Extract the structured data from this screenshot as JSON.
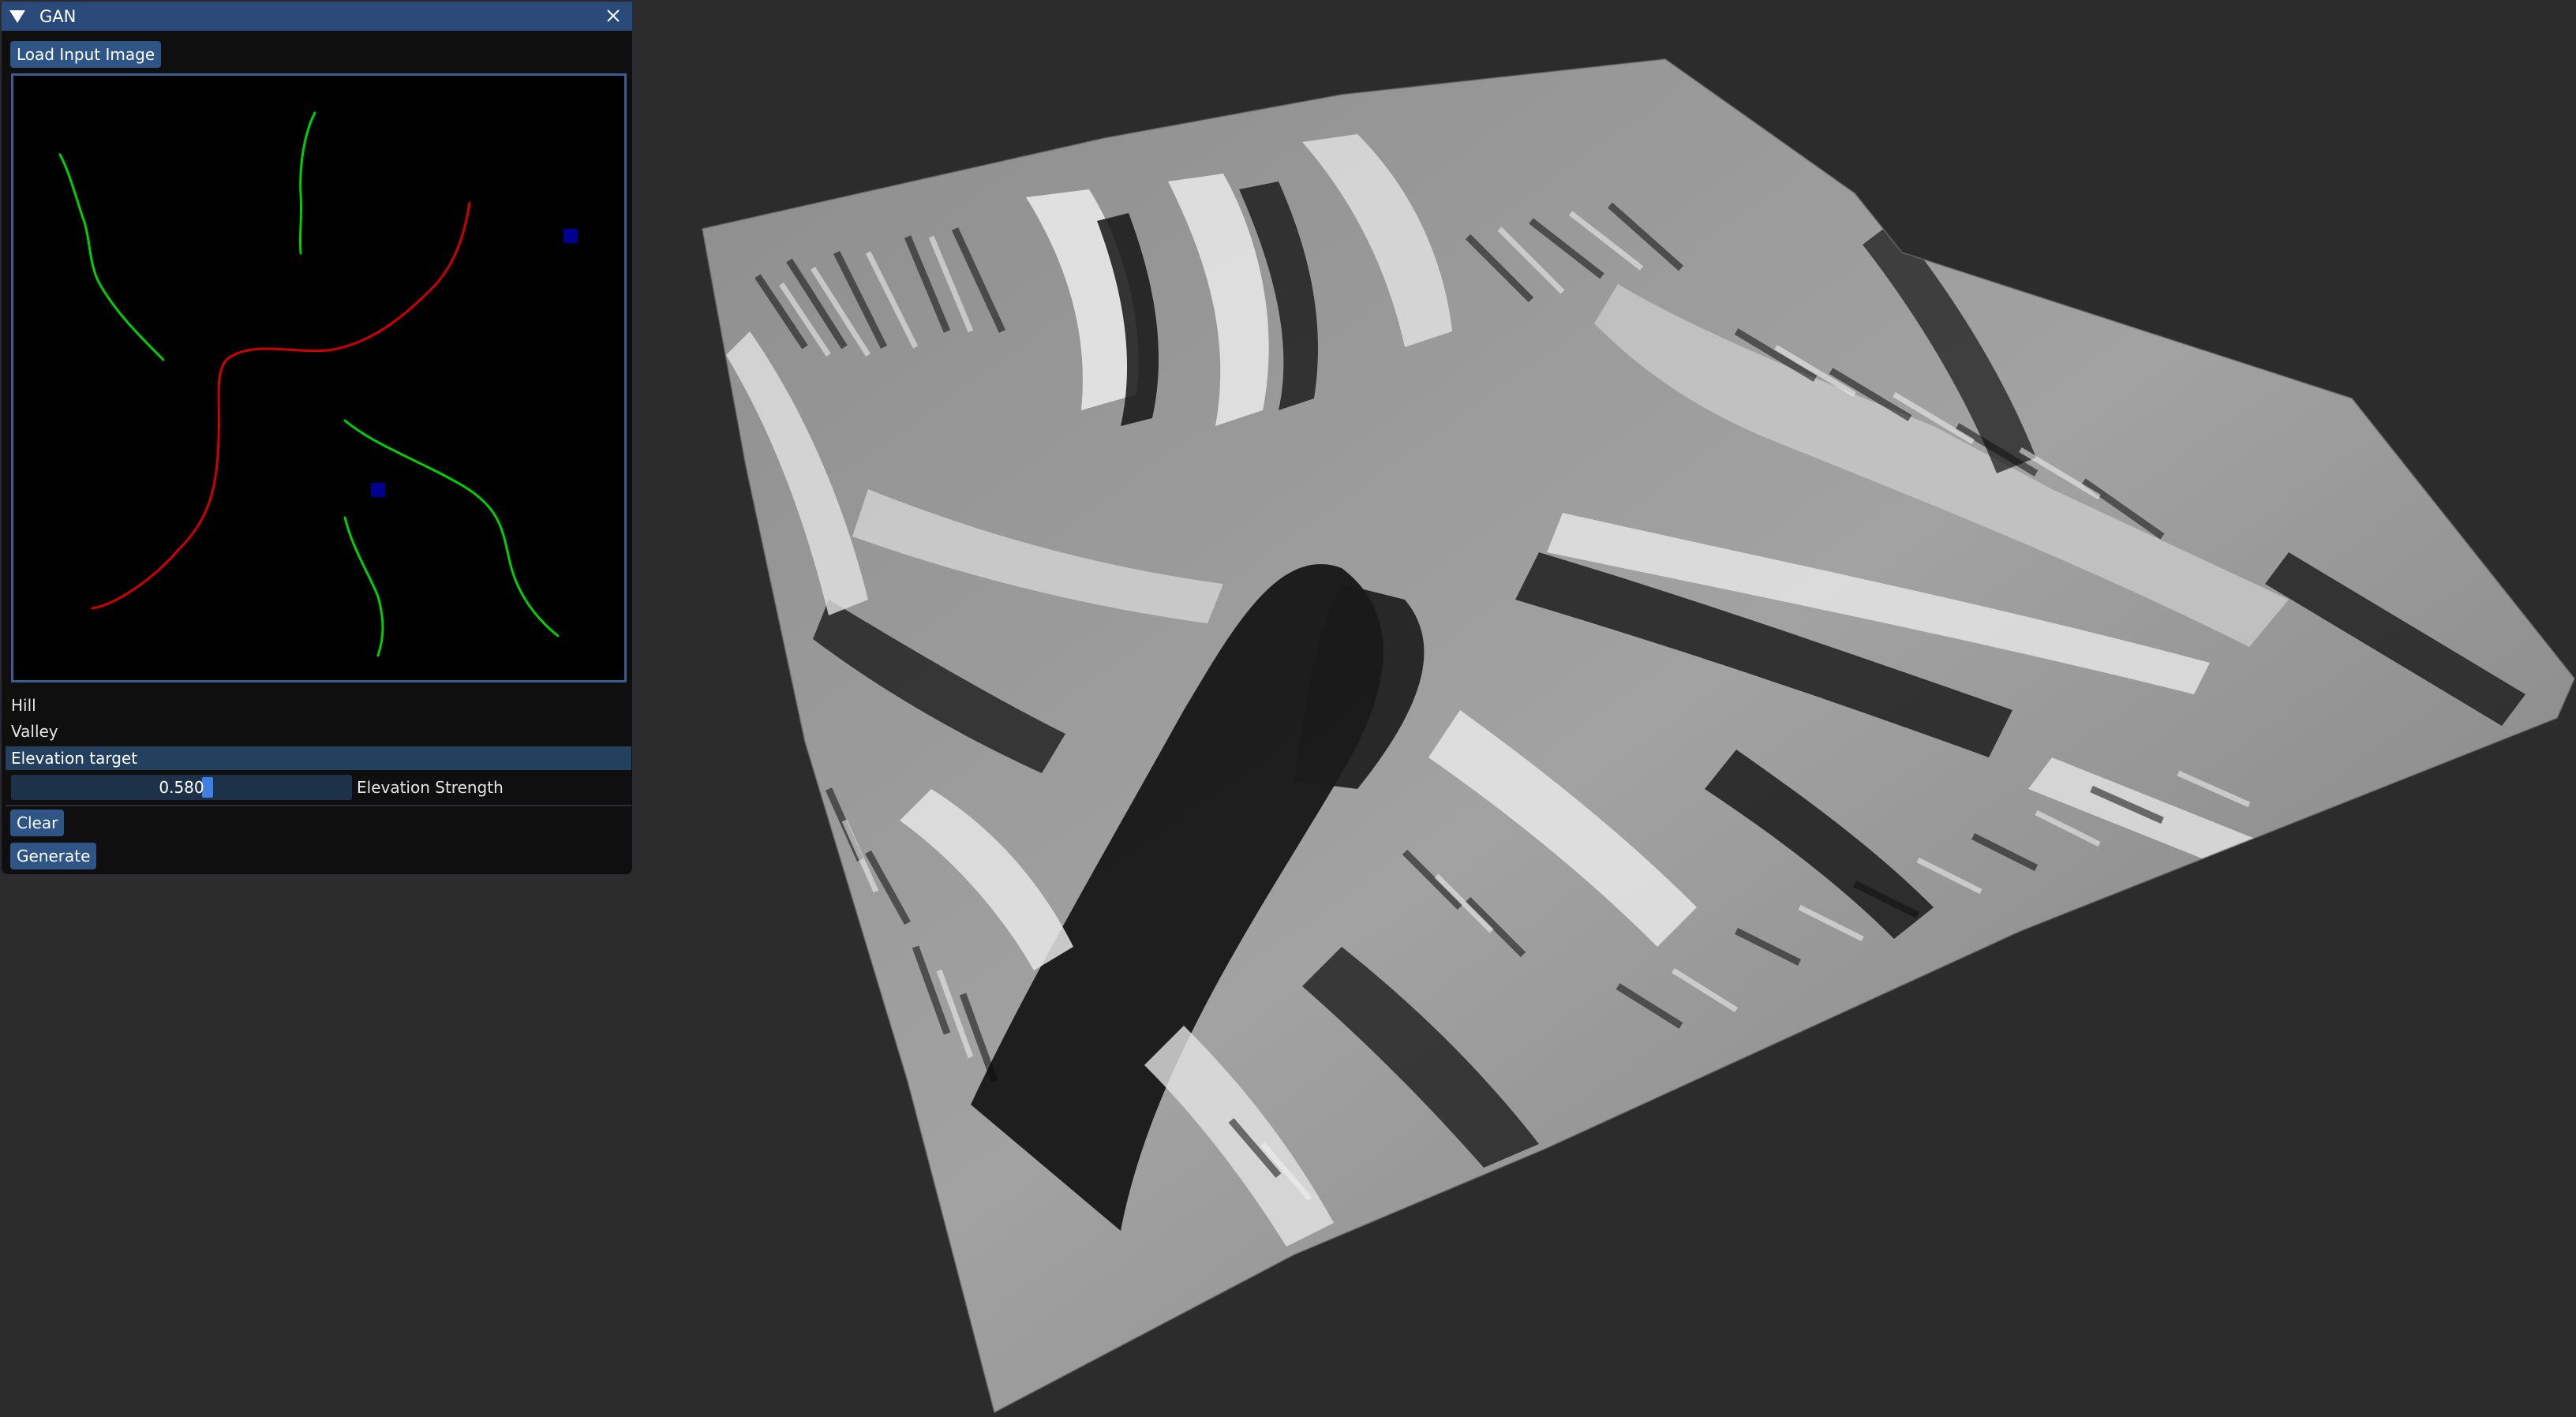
{
  "window": {
    "title": "GAN"
  },
  "toolbar": {
    "load_label": "Load Input Image"
  },
  "labels": {
    "hill": "Hill",
    "valley": "Valley"
  },
  "elevation": {
    "header": "Elevation target",
    "strength_value": "0.580",
    "strength_fraction": 0.58,
    "strength_label": "Elevation Strength"
  },
  "actions": {
    "clear_label": "Clear",
    "generate_label": "Generate"
  },
  "icons": {
    "collapse": "triangle-down-icon",
    "close": "close-icon"
  },
  "colors": {
    "title_bar": "#2a4b79",
    "button": "#2e5585",
    "slider_grab": "#3f7fe0",
    "hill_stroke": "#00d000",
    "valley_stroke": "#d00000",
    "marker": "#000090",
    "background": "#2c2c2c"
  }
}
